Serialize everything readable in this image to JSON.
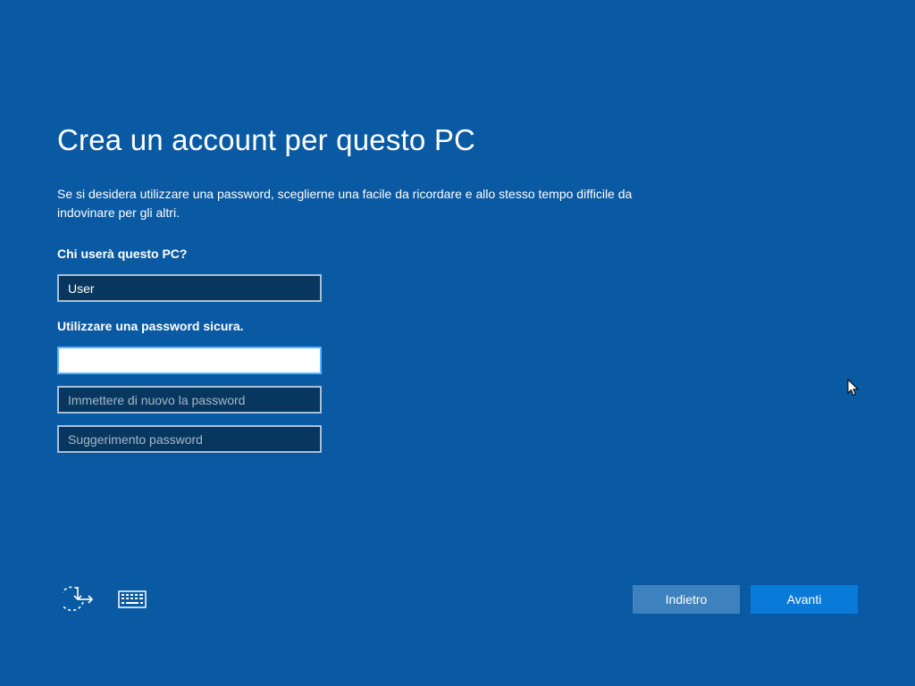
{
  "page": {
    "title": "Crea un account per questo PC",
    "subtitle": "Se si desidera utilizzare una password, sceglierne una facile da ricordare e allo stesso tempo difficile da indovinare per gli altri."
  },
  "form": {
    "username_label": "Chi userà questo PC?",
    "username_value": "User",
    "password_label": "Utilizzare una password sicura.",
    "password_value": "",
    "confirm_placeholder": "Immettere di nuovo la password",
    "hint_placeholder": "Suggerimento password"
  },
  "footer": {
    "icons": [
      "ease-of-access-icon",
      "keyboard-icon"
    ],
    "back_label": "Indietro",
    "next_label": "Avanti"
  },
  "colors": {
    "background": "#0a5aa3",
    "next_button": "#0a7ad8",
    "back_button": "#3d82bf",
    "field_fill": "#07375f"
  }
}
